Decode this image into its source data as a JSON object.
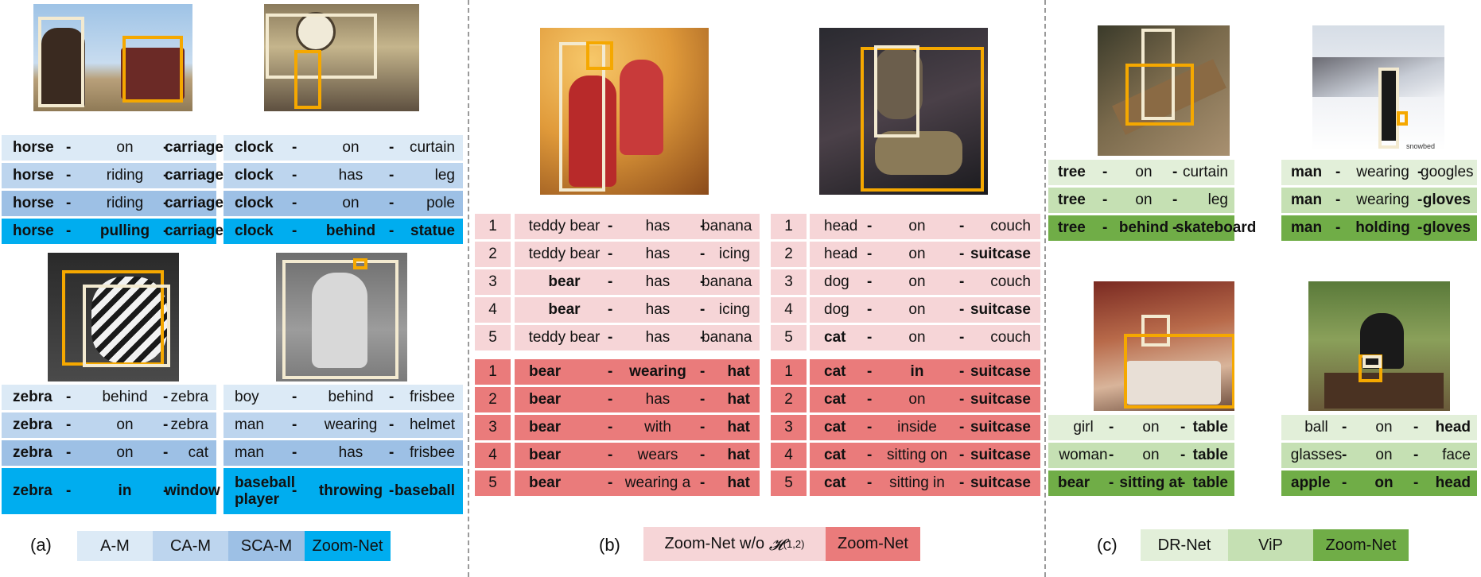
{
  "colors": {
    "am": "#dceaf6",
    "cam": "#bdd5ee",
    "scam": "#9dc0e5",
    "zoom_blue": "#00adef",
    "pink_light": "#f6d5d7",
    "pink_dark": "#ea7b7b",
    "green1": "#e2efd9",
    "green2": "#c5e0b3",
    "green3": "#70ad47",
    "yellow_box": "#f5a800",
    "cream_box": "#f3ead0"
  },
  "panel_a": {
    "label": "(a)",
    "legend": [
      "A-M",
      "CA-M",
      "SCA-M",
      "Zoom-Net"
    ],
    "groups": [
      {
        "rows": [
          [
            "horse",
            "on",
            "carriage"
          ],
          [
            "horse",
            "riding",
            "carriage"
          ],
          [
            "horse",
            "riding",
            "carriage"
          ],
          [
            "horse",
            "pulling",
            "carriage"
          ]
        ]
      },
      {
        "rows": [
          [
            "clock",
            "on",
            "curtain"
          ],
          [
            "clock",
            "has",
            "leg"
          ],
          [
            "clock",
            "on",
            "pole"
          ],
          [
            "clock",
            "behind",
            "statue"
          ]
        ]
      },
      {
        "rows": [
          [
            "zebra",
            "behind",
            "zebra"
          ],
          [
            "zebra",
            "on",
            "zebra"
          ],
          [
            "zebra",
            "on",
            "cat"
          ],
          [
            "zebra",
            "in",
            "window"
          ]
        ]
      },
      {
        "rows": [
          [
            "boy",
            "behind",
            "frisbee"
          ],
          [
            "man",
            "wearing",
            "helmet"
          ],
          [
            "man",
            "has",
            "frisbee"
          ],
          [
            "baseball player",
            "throwing",
            "baseball"
          ]
        ]
      }
    ]
  },
  "panel_b": {
    "label": "(b)",
    "legend_1": "Zoom-Net w/o ",
    "legend_1_math": "𝓗",
    "legend_1_sup": "(1,2)",
    "legend_2": "Zoom-Net",
    "groups": [
      {
        "top": [
          [
            "1",
            "teddy bear",
            "has",
            "banana"
          ],
          [
            "2",
            "teddy bear",
            "has",
            "icing"
          ],
          [
            "3",
            "bear",
            "has",
            "banana"
          ],
          [
            "4",
            "bear",
            "has",
            "icing"
          ],
          [
            "5",
            "teddy bear",
            "has",
            "banana"
          ]
        ],
        "bottom": [
          [
            "1",
            "bear",
            "wearing",
            "hat"
          ],
          [
            "2",
            "bear",
            "has",
            "hat"
          ],
          [
            "3",
            "bear",
            "with",
            "hat"
          ],
          [
            "4",
            "bear",
            "wears",
            "hat"
          ],
          [
            "5",
            "bear",
            "wearing a",
            "hat"
          ]
        ]
      },
      {
        "top": [
          [
            "1",
            "head",
            "on",
            "couch"
          ],
          [
            "2",
            "head",
            "on",
            "suitcase"
          ],
          [
            "3",
            "dog",
            "on",
            "couch"
          ],
          [
            "4",
            "dog",
            "on",
            "suitcase"
          ],
          [
            "5",
            "cat",
            "on",
            "couch"
          ]
        ],
        "bottom": [
          [
            "1",
            "cat",
            "in",
            "suitcase"
          ],
          [
            "2",
            "cat",
            "on",
            "suitcase"
          ],
          [
            "3",
            "cat",
            "inside",
            "suitcase"
          ],
          [
            "4",
            "cat",
            "sitting on",
            "suitcase"
          ],
          [
            "5",
            "cat",
            "sitting in",
            "suitcase"
          ]
        ]
      }
    ]
  },
  "panel_c": {
    "label": "(c)",
    "legend": [
      "DR-Net",
      "ViP",
      "Zoom-Net"
    ],
    "groups": [
      {
        "rows": [
          [
            "tree",
            "on",
            "curtain"
          ],
          [
            "tree",
            "on",
            "leg"
          ],
          [
            "tree",
            "behind",
            "skateboard"
          ]
        ]
      },
      {
        "rows": [
          [
            "man",
            "wearing",
            "googles"
          ],
          [
            "man",
            "wearing",
            "gloves"
          ],
          [
            "man",
            "holding",
            "gloves"
          ]
        ]
      },
      {
        "rows": [
          [
            "girl",
            "on",
            "table"
          ],
          [
            "woman",
            "on",
            "table"
          ],
          [
            "bear",
            "sitting at",
            "table"
          ]
        ]
      },
      {
        "rows": [
          [
            "ball",
            "on",
            "head"
          ],
          [
            "glasses",
            "on",
            "face"
          ],
          [
            "apple",
            "on",
            "head"
          ]
        ]
      }
    ],
    "watermark": "snowbed"
  }
}
